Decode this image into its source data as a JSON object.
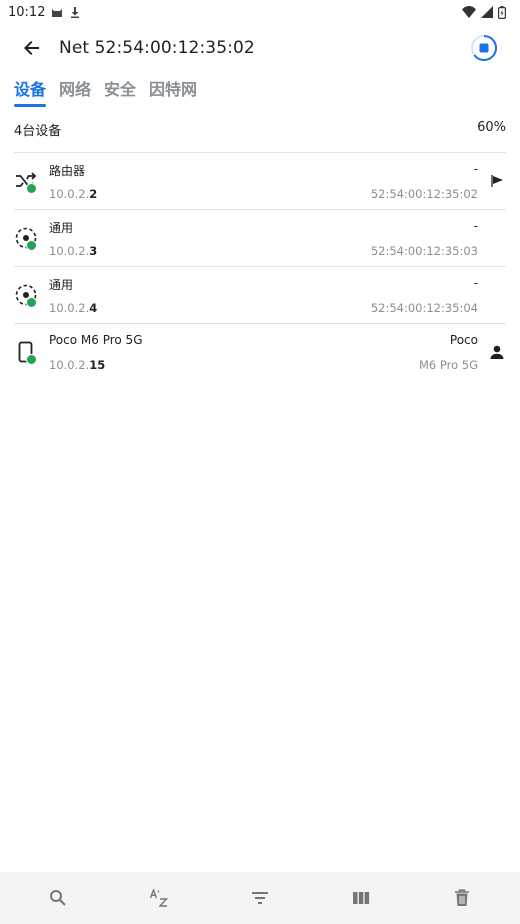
{
  "statusbar": {
    "time": "10:12"
  },
  "appbar": {
    "title": "Net 52:54:00:12:35:02"
  },
  "tabs": [
    {
      "label": "设备",
      "active": true
    },
    {
      "label": "网络",
      "active": false
    },
    {
      "label": "安全",
      "active": false
    },
    {
      "label": "因特网",
      "active": false
    }
  ],
  "summary": {
    "count": "4台设备",
    "percent": "60%"
  },
  "devices": [
    {
      "icon": "router-shuffle-icon",
      "name": "路由器",
      "ip_prefix": "10.0.2.",
      "ip_last": "2",
      "vendor": "-",
      "mac": "52:54:00:12:35:02",
      "trail_icon": "flag-icon"
    },
    {
      "icon": "generic-device-icon",
      "name": "通用",
      "ip_prefix": "10.0.2.",
      "ip_last": "3",
      "vendor": "-",
      "mac": "52:54:00:12:35:03",
      "trail_icon": ""
    },
    {
      "icon": "generic-device-icon",
      "name": "通用",
      "ip_prefix": "10.0.2.",
      "ip_last": "4",
      "vendor": "-",
      "mac": "52:54:00:12:35:04",
      "trail_icon": ""
    },
    {
      "icon": "phone-icon",
      "name": "Poco M6 Pro 5G",
      "ip_prefix": "10.0.2.",
      "ip_last": "15",
      "vendor": "Poco",
      "mac": "M6 Pro 5G",
      "trail_icon": "person-icon"
    }
  ],
  "bottombar": [
    "search-icon",
    "sort-az-icon",
    "filter-icon",
    "columns-icon",
    "delete-icon"
  ],
  "colors": {
    "accent": "#1a73e8",
    "online": "#22a355",
    "muted": "#8a8f94",
    "bottombar_bg": "#f4f4f5"
  }
}
